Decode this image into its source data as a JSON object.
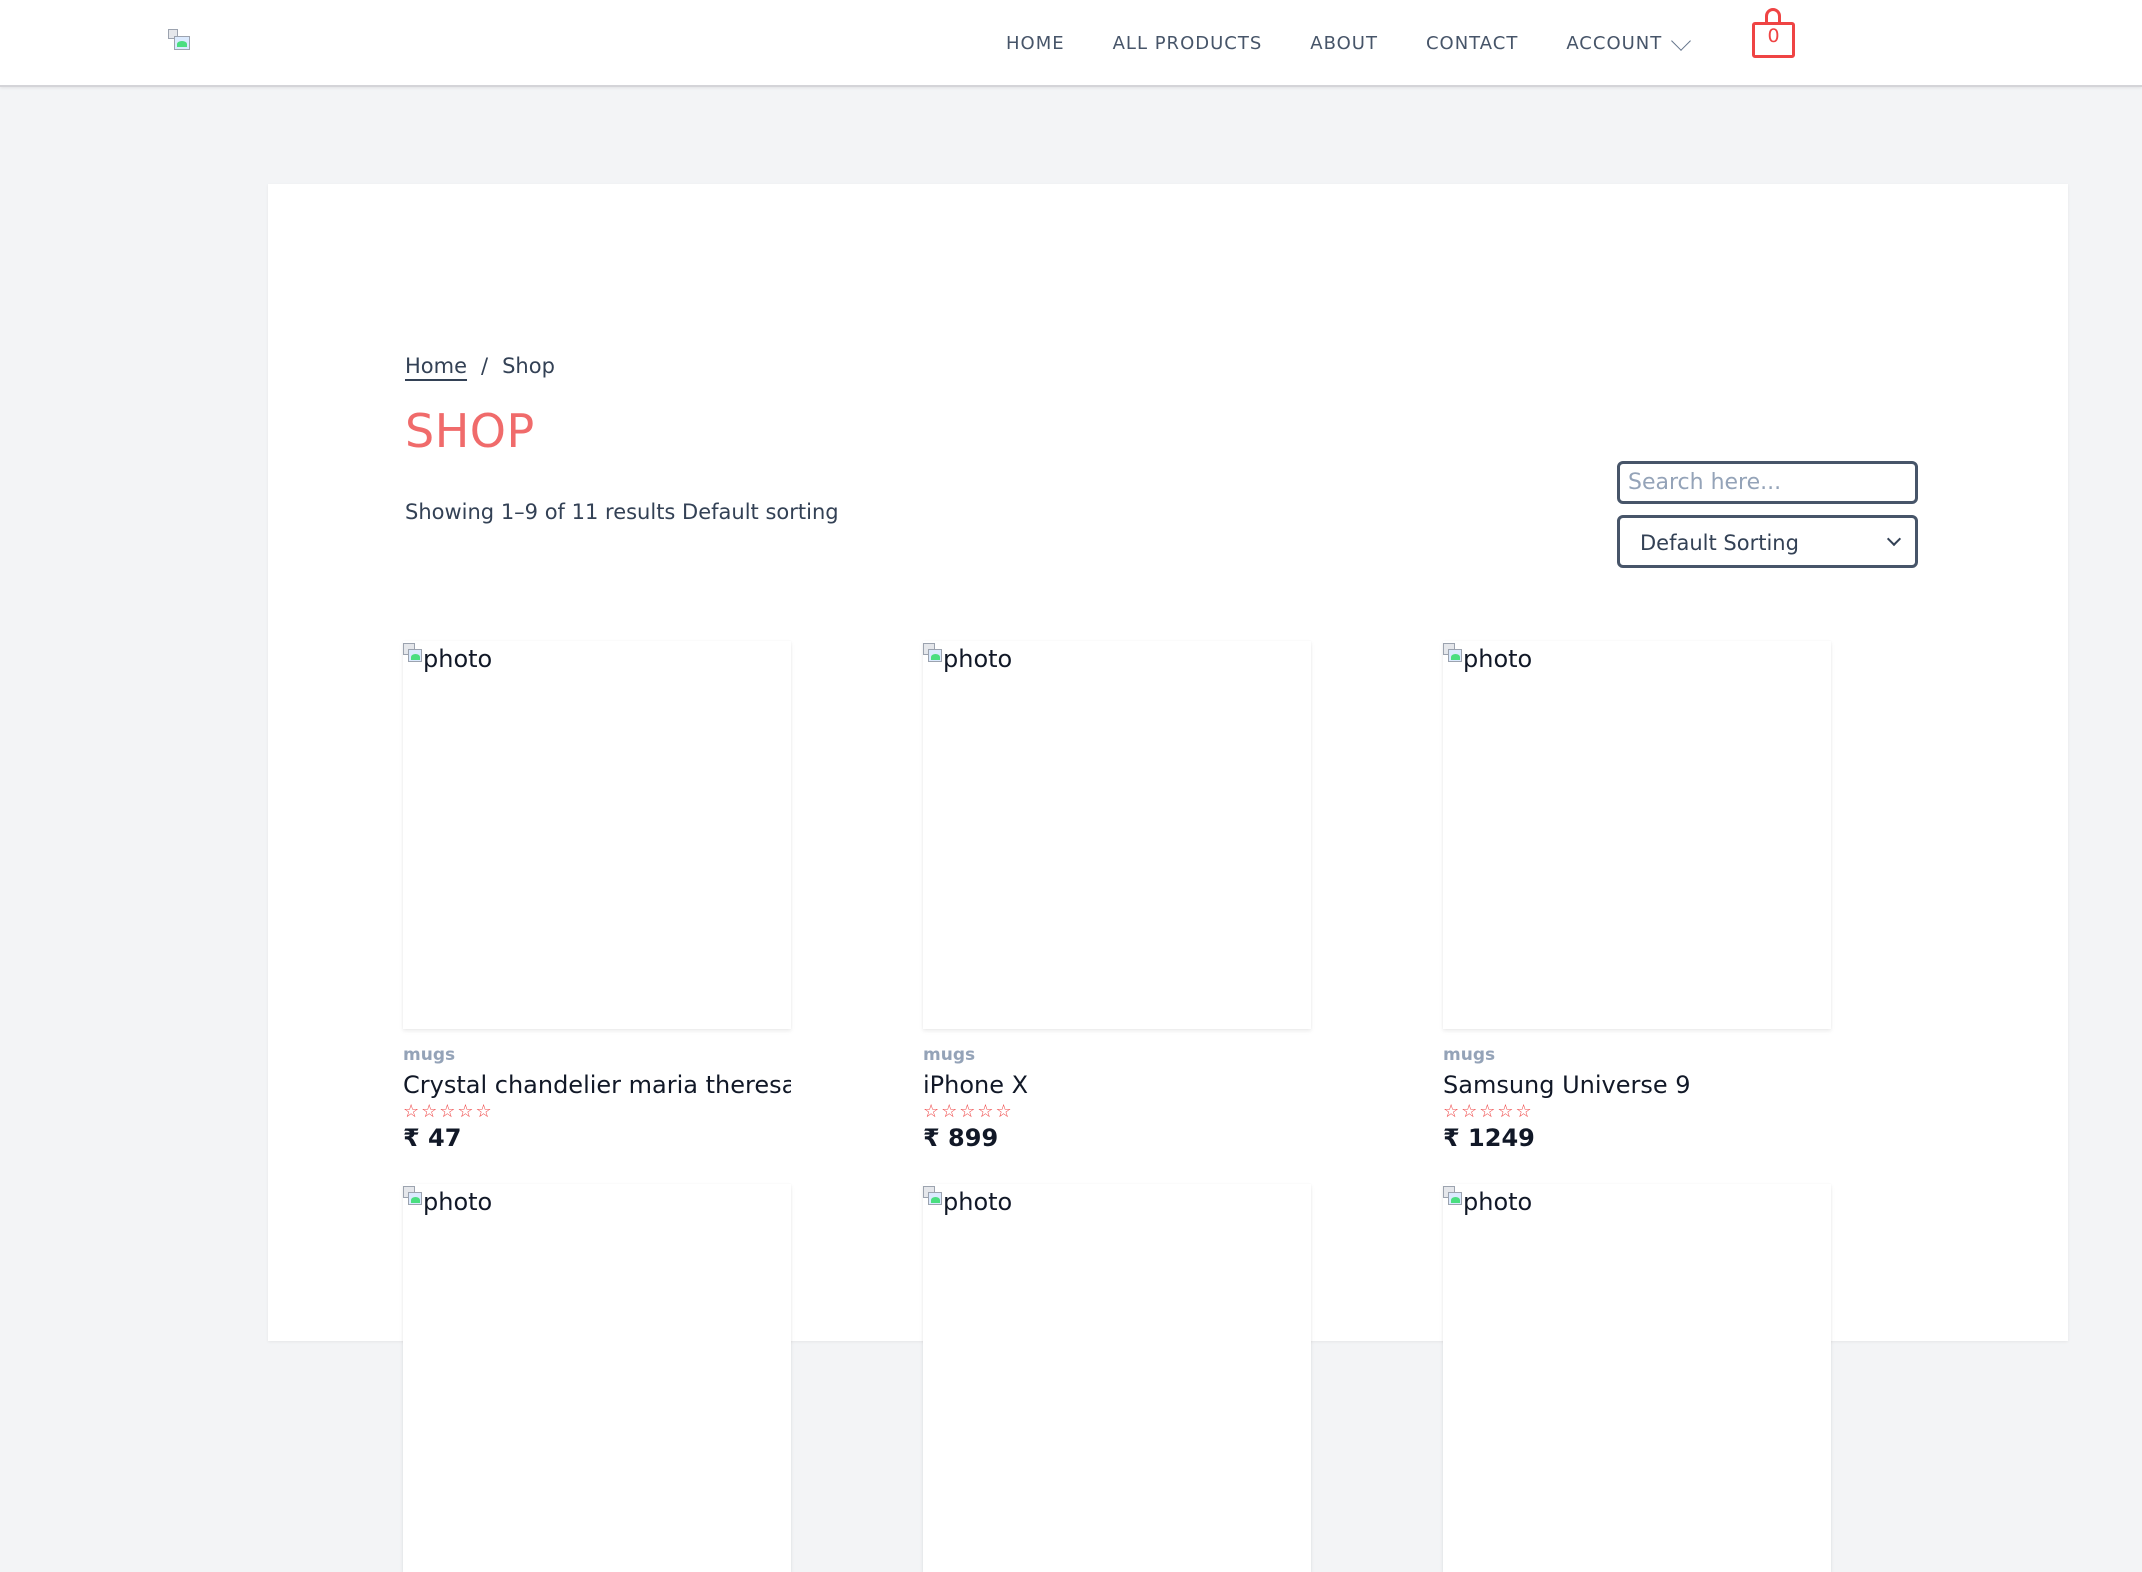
{
  "header": {
    "logo_alt": "",
    "nav": [
      {
        "label": "HOME"
      },
      {
        "label": "ALL PRODUCTS"
      },
      {
        "label": "ABOUT"
      },
      {
        "label": "CONTACT"
      },
      {
        "label": "ACCOUNT"
      }
    ],
    "cart_count": "0"
  },
  "breadcrumb": {
    "home": "Home",
    "separator": "/",
    "current": "Shop"
  },
  "page": {
    "title": "SHOP",
    "results_text": "Showing 1–9 of 11 results Default sorting"
  },
  "controls": {
    "search_placeholder": "Search here...",
    "sort_value": "Default Sorting"
  },
  "colors": {
    "accent": "#ef4444",
    "title": "#f06b6b"
  },
  "products": [
    {
      "image_alt": "photo",
      "category": "mugs",
      "name": "Crystal chandelier maria theresa for",
      "rating": 0,
      "stars": "☆☆☆☆☆",
      "price": "₹ 47"
    },
    {
      "image_alt": "photo",
      "category": "mugs",
      "name": "iPhone X",
      "rating": 0,
      "stars": "☆☆☆☆☆",
      "price": "₹ 899"
    },
    {
      "image_alt": "photo",
      "category": "mugs",
      "name": "Samsung Universe 9",
      "rating": 0,
      "stars": "☆☆☆☆☆",
      "price": "₹ 1249"
    },
    {
      "image_alt": "photo"
    },
    {
      "image_alt": "photo"
    },
    {
      "image_alt": "photo"
    }
  ]
}
